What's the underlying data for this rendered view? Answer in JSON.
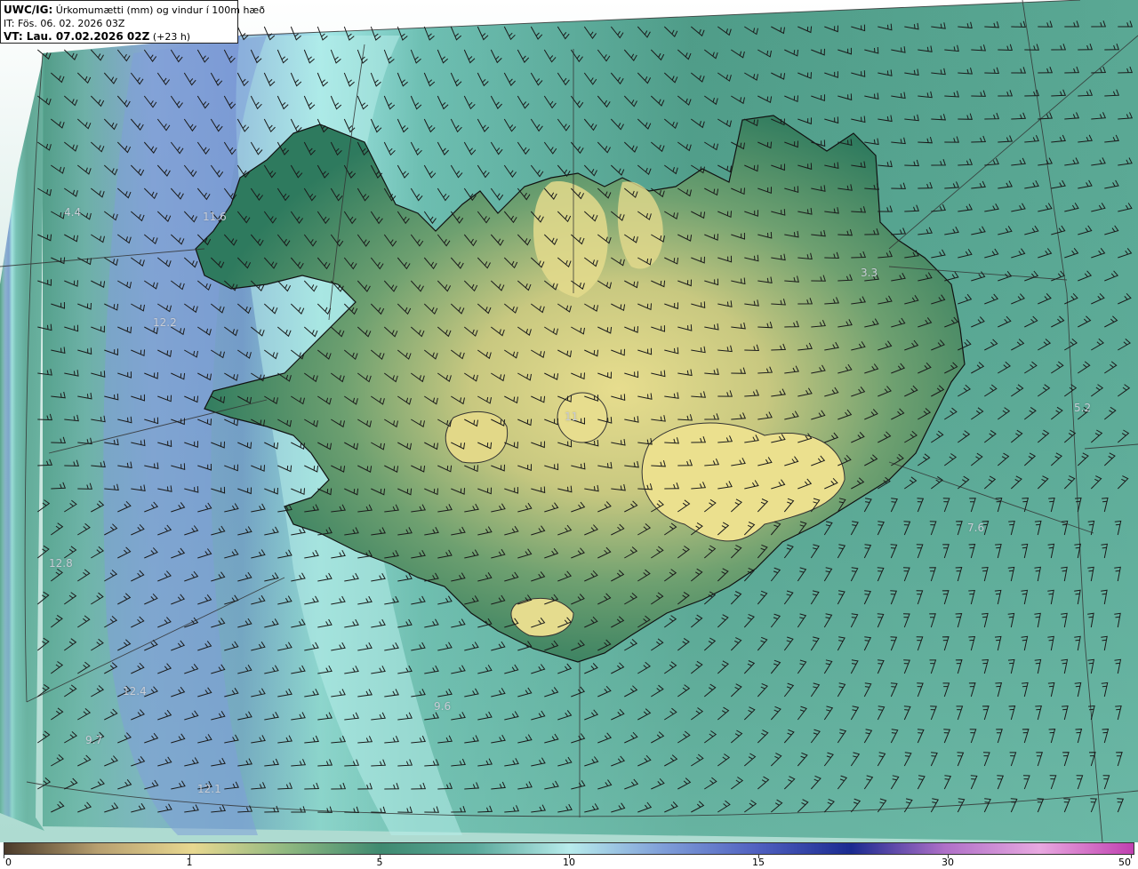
{
  "header": {
    "model_label": "UWC/IG:",
    "parameter": "Úrkomumætti (mm) og vindur í 100m hæð",
    "init_time": "IT: Fös. 06. 02. 2026 03Z",
    "valid_prefix": "VT: Lau. 07.02.2026 02Z",
    "lead": "(+23 h)"
  },
  "stations": [
    {
      "label": "4.4"
    },
    {
      "label": "11.6"
    },
    {
      "label": "12.2"
    },
    {
      "label": "12.8"
    },
    {
      "label": "12.4"
    },
    {
      "label": "9.7"
    },
    {
      "label": "12.1"
    },
    {
      "label": "9.6"
    },
    {
      "label": "3.3"
    },
    {
      "label": "5.2"
    },
    {
      "label": "7.6"
    },
    {
      "label": "11"
    }
  ],
  "colorbar": {
    "ticks": [
      "0",
      "1",
      "5",
      "10",
      "15",
      "30",
      "50"
    ],
    "colors": [
      "#4a3a2a",
      "#b8a070",
      "#e8d890",
      "#8fb880",
      "#3f8a70",
      "#5aa89a",
      "#b8ecec",
      "#7f9ed8",
      "#5060c0",
      "#1a2a90",
      "#b070c8",
      "#e8a8e0",
      "#c040b0"
    ]
  },
  "palette": {
    "ocean_light": "#aee6e4",
    "ocean_teal": "#5fae9e",
    "ocean_deep_teal": "#3f8f7c",
    "blue_band": "#7f9ed8",
    "land_green": "#2f7a5e",
    "land_yellow": "#e6dc8c"
  }
}
